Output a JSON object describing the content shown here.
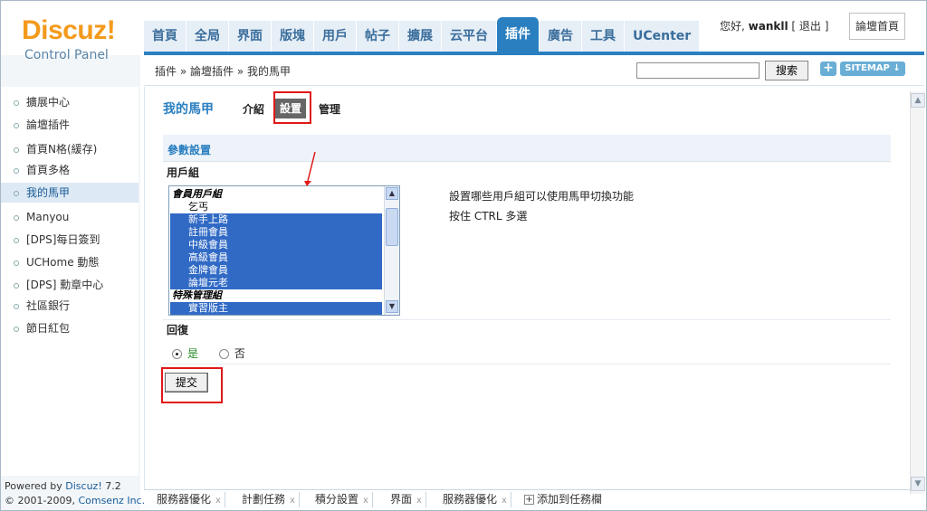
{
  "header": {
    "logo_name": "Discuz!",
    "logo_sub": "Control Panel",
    "nav_tabs": [
      "首頁",
      "全局",
      "界面",
      "版塊",
      "用戶",
      "帖子",
      "擴展",
      "云平台",
      "插件",
      "廣告",
      "工具",
      "UCenter"
    ],
    "active_tab_index": 8,
    "greeting": "您好,",
    "username": "wankll",
    "logout_label": "[ 退出 ]",
    "forum_home_label": "論壇首頁"
  },
  "breadcrumb": {
    "items": [
      "插件",
      "論壇插件",
      "我的馬甲"
    ],
    "separator": "»"
  },
  "search": {
    "value": "",
    "button_label": "搜索"
  },
  "toolbar": {
    "plus_label": "+",
    "sitemap_label": "SITEMAP"
  },
  "sidebar": {
    "items": [
      {
        "label": "擴展中心"
      },
      {
        "label": "論壇插件"
      },
      {
        "label": "首頁N格(緩存)"
      },
      {
        "label": "首頁多格"
      },
      {
        "label": "我的馬甲",
        "active": true
      },
      {
        "label": "Manyou"
      },
      {
        "label": "[DPS]每日簽到"
      },
      {
        "label": "UCHome 動態"
      },
      {
        "label": "[DPS] 勳章中心"
      },
      {
        "label": "社區銀行"
      },
      {
        "label": "節日紅包"
      }
    ],
    "footer_powered": "Powered by",
    "footer_product": "Discuz!",
    "footer_version": "7.2",
    "footer_copyright": "© 2001-2009,",
    "footer_company": "Comsenz Inc."
  },
  "main": {
    "plugin_title": "我的馬甲",
    "sub_tabs": {
      "intro": "介紹",
      "settings": "設置",
      "manage": "管理"
    },
    "section_title": "參數設置",
    "usergroup_label": "用戶組",
    "usergroup_options": [
      {
        "label": "會員用戶組",
        "group": true,
        "selected": false
      },
      {
        "label": "乞丐",
        "group": false,
        "selected": false
      },
      {
        "label": "新手上路",
        "group": false,
        "selected": true
      },
      {
        "label": "註冊會員",
        "group": false,
        "selected": true
      },
      {
        "label": "中級會員",
        "group": false,
        "selected": true
      },
      {
        "label": "高級會員",
        "group": false,
        "selected": true
      },
      {
        "label": "金牌會員",
        "group": false,
        "selected": true
      },
      {
        "label": "論壇元老",
        "group": false,
        "selected": true
      },
      {
        "label": "特殊管理組",
        "group": true,
        "selected": false
      },
      {
        "label": "實習版主",
        "group": false,
        "selected": true
      }
    ],
    "usergroup_desc_1": "設置哪些用戶組可以使用馬甲切換功能",
    "usergroup_desc_2": "按住 CTRL 多選",
    "reply_label": "回復",
    "radio_yes": "是",
    "radio_no": "否",
    "radio_selected": "是",
    "submit_label": "提交"
  },
  "taskbar": {
    "tasks": [
      "服務器優化",
      "計劃任務",
      "積分設置",
      "界面",
      "服務器優化"
    ],
    "close_glyph": "x",
    "add_label": "添加到任務欄"
  },
  "colors": {
    "accent": "#2a7fc0",
    "logo": "#f39a1c",
    "selection": "#316ac5",
    "annotation_red": "#e01818"
  }
}
